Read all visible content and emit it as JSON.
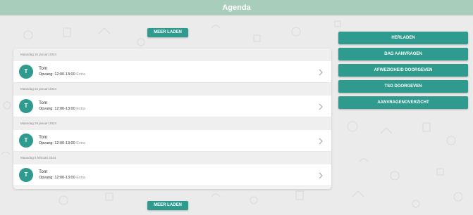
{
  "header": {
    "title": "Agenda"
  },
  "actions": {
    "load_more_top": "MEER LADEN",
    "load_more_bottom": "MEER LADEN"
  },
  "agenda": [
    {
      "date": "Maandag 15 januari 2024",
      "initial": "T",
      "name": "Tom",
      "time": "Opvang: 12:00-13:00",
      "tag": "Extra"
    },
    {
      "date": "Maandag 22 januari 2024",
      "initial": "T",
      "name": "Tom",
      "time": "Opvang: 12:00-13:00",
      "tag": "Extra"
    },
    {
      "date": "Maandag 29 januari 2024",
      "initial": "T",
      "name": "Tom",
      "time": "Opvang: 12:00-13:00",
      "tag": "Extra"
    },
    {
      "date": "Maandag 5 februari 2024",
      "initial": "T",
      "name": "Tom",
      "time": "Opvang: 12:00-13:00",
      "tag": "Extra"
    }
  ],
  "sidebar": {
    "buttons": [
      "HERLADEN",
      "DAG AANVRAGEN",
      "AFWEZIGHEID DOORGEVEN",
      "TSO DOORGEVEN",
      "AANVRAGENOVERZICHT"
    ]
  },
  "colors": {
    "accent": "#2f9b8e",
    "header": "#a9cdbb",
    "background": "#ebebeb"
  },
  "icons": {
    "avatar": "avatar-initial",
    "chevron": "chevron-right-icon",
    "background": "doodle-pattern"
  }
}
